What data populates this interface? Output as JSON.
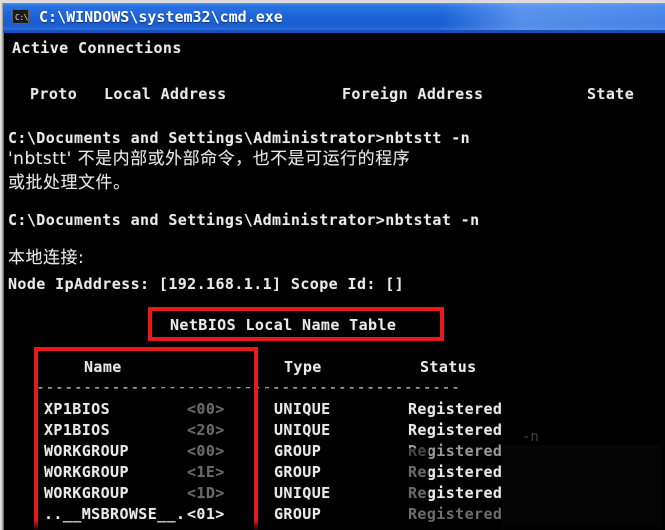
{
  "window": {
    "title": "C:\\WINDOWS\\system32\\cmd.exe",
    "icon": "cmd-console-icon",
    "icon_glyph": "C:\\",
    "titlebar_color": "#1c63d8",
    "background_color": "#000000",
    "text_color": "#e9e9e9"
  },
  "annotations": {
    "accent_color": "#e61a1a",
    "box1_label": "netbios-local-name-table-highlight",
    "box2_label": "name-column-highlight"
  },
  "console": {
    "netstat_output": {
      "heading": "Active Connections",
      "columns": [
        "Proto",
        "Local Address",
        "Foreign Address",
        "State"
      ]
    },
    "failed_command": {
      "prompt": "C:\\Documents and Settings\\Administrator>",
      "command": "nbtstt -n",
      "error_line1": "'nbtstt' 不是内部或外部命令，也不是可运行的程序",
      "error_line2": "或批处理文件。"
    },
    "nbtstat": {
      "prompt": "C:\\Documents and Settings\\Administrator>",
      "command": "nbtstat -n",
      "adapter": "本地连接:",
      "node": "Node IpAddress: [192.168.1.1] Scope Id: []",
      "table_title": "NetBIOS Local Name Table",
      "columns": [
        "Name",
        "Type",
        "Status"
      ],
      "separator": "---------------------------------------------",
      "rows": [
        {
          "name": "XP1BIOS",
          "code": "<00>",
          "type": "UNIQUE",
          "status": "Registered"
        },
        {
          "name": "XP1BIOS",
          "code": "<20>",
          "type": "UNIQUE",
          "status": "Registered"
        },
        {
          "name": "WORKGROUP",
          "code": "<00>",
          "type": "GROUP",
          "status": "Registered"
        },
        {
          "name": "WORKGROUP",
          "code": "<1E>",
          "type": "GROUP",
          "status": "Registered"
        },
        {
          "name": "WORKGROUP",
          "code": "<1D>",
          "type": "UNIQUE",
          "status": "Registered"
        },
        {
          "name": "..__MSBROWSE__.",
          "code": "<01>",
          "type": "GROUP",
          "status": "Registered"
        }
      ]
    },
    "artifact_text": "-n"
  }
}
